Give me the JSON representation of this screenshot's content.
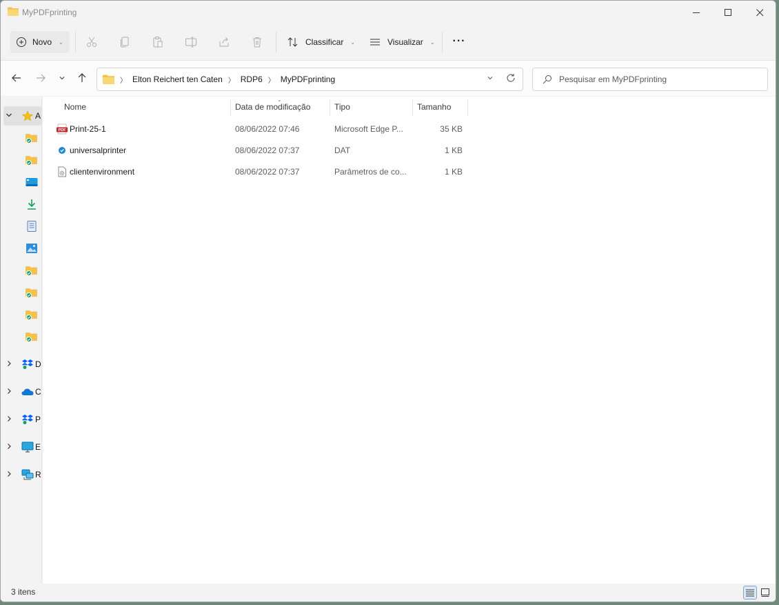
{
  "window": {
    "title": "MyPDFprinting"
  },
  "toolbar": {
    "new_label": "Novo",
    "sort_label": "Classificar",
    "view_label": "Visualizar",
    "more_label": "···"
  },
  "address": {
    "crumbs": [
      "Elton Reichert ten Caten",
      "RDP6",
      "MyPDFprinting"
    ]
  },
  "search": {
    "placeholder": "Pesquisar em MyPDFprinting"
  },
  "columns": {
    "name": "Nome",
    "modified": "Data de modificação",
    "type": "Tipo",
    "size": "Tamanho"
  },
  "files": [
    {
      "name": "Print-25-1",
      "modified": "08/06/2022 07:46",
      "type": "Microsoft Edge P...",
      "size": "35 KB",
      "icon": "pdf-file-icon"
    },
    {
      "name": "universalprinter",
      "modified": "08/06/2022 07:37",
      "type": "DAT",
      "size": "1 KB",
      "icon": "dat-file-icon"
    },
    {
      "name": "clientenvironment",
      "modified": "08/06/2022 07:37",
      "type": "Parâmetros de co...",
      "size": "1 KB",
      "icon": "config-file-icon"
    }
  ],
  "sidebar": {
    "quick_access_letter": "A",
    "nodes": [
      {
        "letter": "D",
        "icon": "dropbox-icon"
      },
      {
        "letter": "C",
        "icon": "onedrive-icon"
      },
      {
        "letter": "P",
        "icon": "dropbox-icon"
      },
      {
        "letter": "E",
        "icon": "this-pc-icon"
      },
      {
        "letter": "R",
        "icon": "network-icon"
      }
    ]
  },
  "status": {
    "item_count": "3 itens"
  },
  "colors": {
    "folder": "#f2c14e",
    "accent": "#0067c0",
    "pdf_red": "#c4262e",
    "onedrive_blue": "#0f78d4"
  }
}
